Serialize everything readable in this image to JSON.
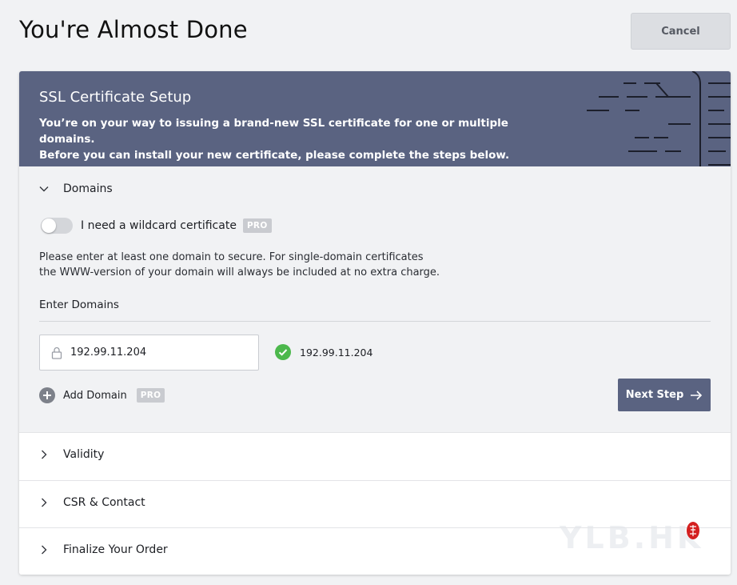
{
  "page": {
    "title": "You're Almost Done",
    "cancel_label": "Cancel"
  },
  "banner": {
    "title": "SSL Certificate Setup",
    "desc_line1": "You’re on your way to issuing a brand-new SSL certificate for one or multiple domains.",
    "desc_line2": "Before you can install your new certificate, please complete the steps below."
  },
  "domains_section": {
    "label": "Domains",
    "expanded": true,
    "wildcard_toggle": {
      "label": "I need a wildcard certificate",
      "on": false,
      "badge": "PRO"
    },
    "help_line1": "Please enter at least one domain to secure. For single-domain certificates",
    "help_line2": "the WWW-version of your domain will always be included at no extra charge.",
    "enter_label": "Enter Domains",
    "domain_value": "192.99.11.204",
    "verified_domain": "192.99.11.204",
    "add_domain_label": "Add Domain",
    "add_domain_badge": "PRO",
    "next_label": "Next Step"
  },
  "collapsed_sections": [
    {
      "label": "Validity"
    },
    {
      "label": "CSR & Contact"
    },
    {
      "label": "Finalize Your Order"
    }
  ],
  "watermark": {
    "text": "YLB.HK"
  },
  "colors": {
    "page_bg": "#f1f2f4",
    "banner_bg": "#5a6381",
    "accent": "#5a6381",
    "success": "#4cb84c",
    "badge_bg": "#c9cbd0"
  }
}
